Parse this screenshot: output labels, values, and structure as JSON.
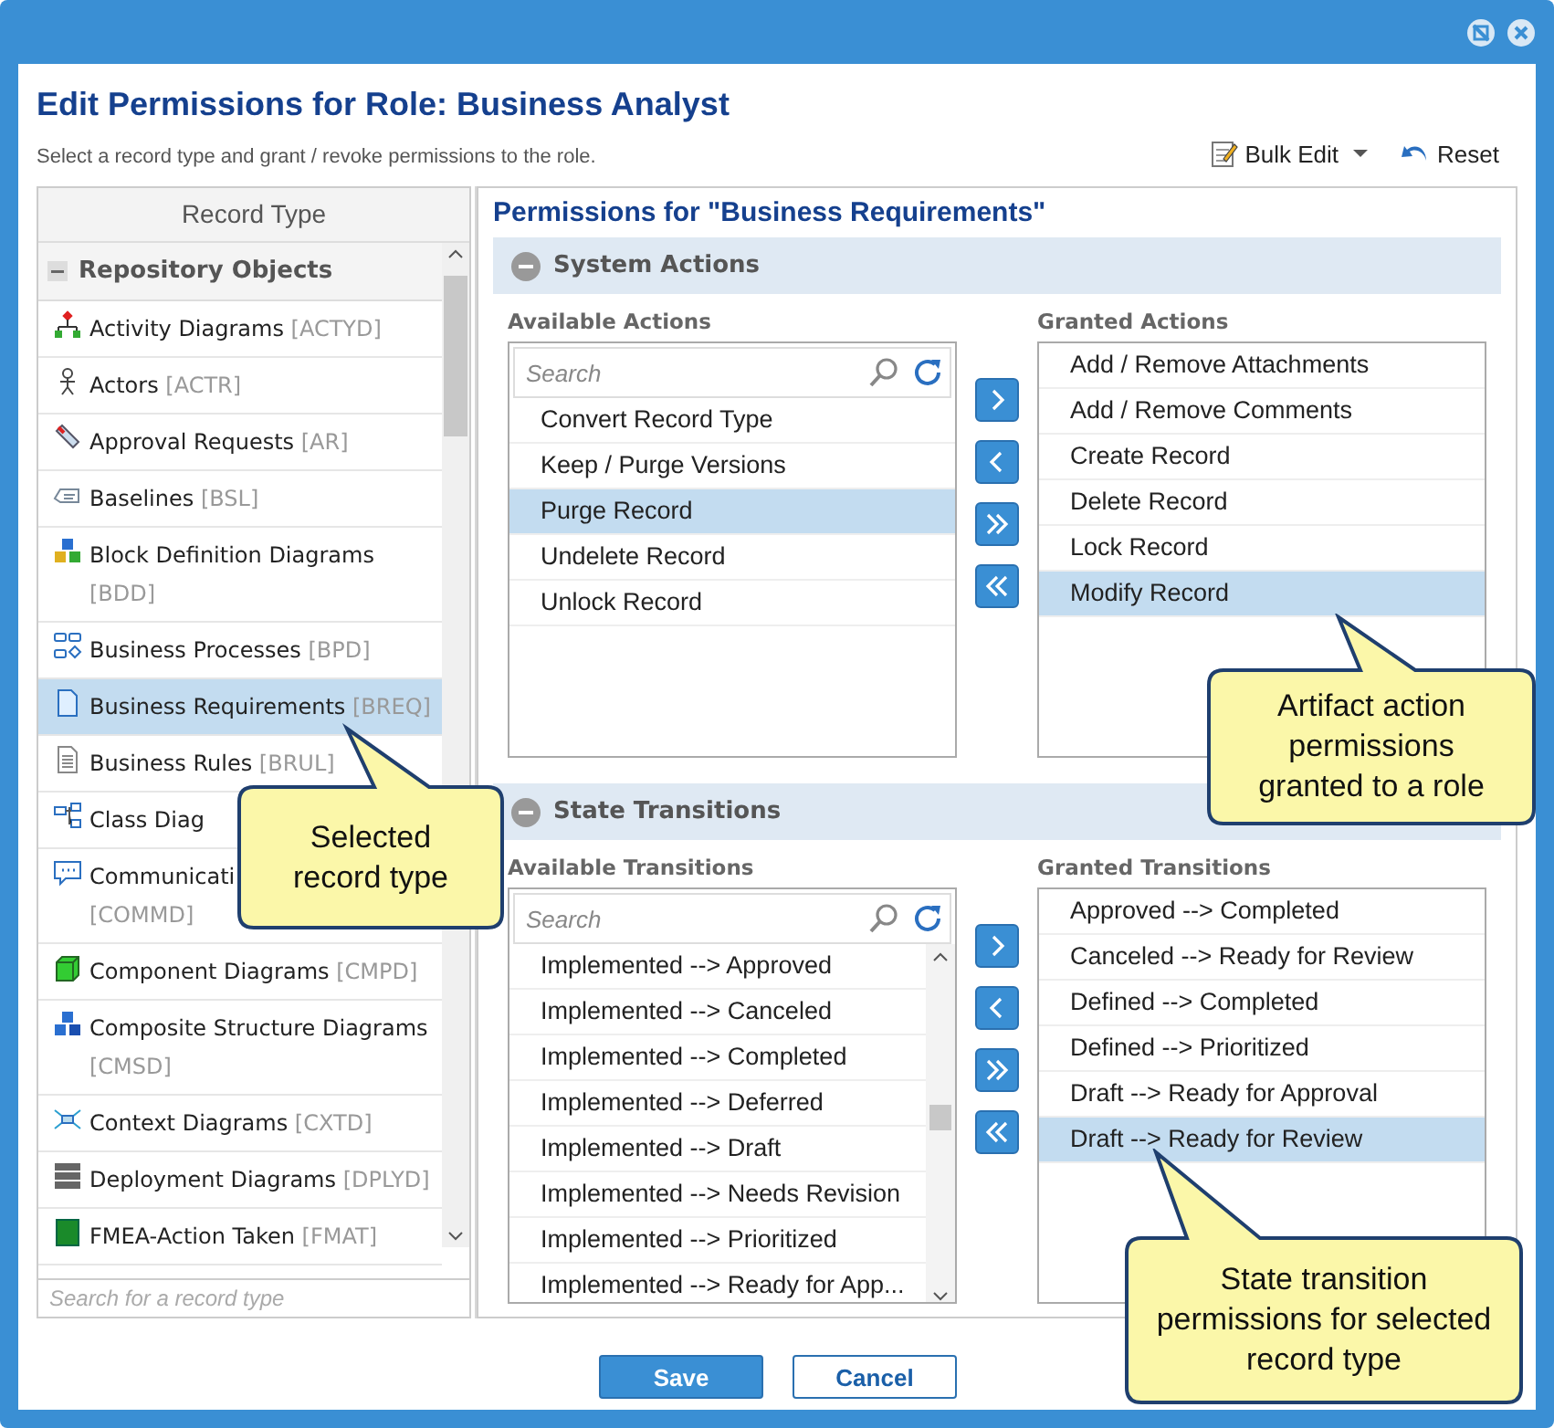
{
  "dialog": {
    "title": "Edit Permissions for Role: Business Analyst",
    "subtitle": "Select a record type and grant / revoke permissions to the role."
  },
  "toolbar": [
    {
      "label": "Bulk Edit",
      "kind": "dropdown"
    },
    {
      "label": "Reset",
      "kind": "undo"
    }
  ],
  "record_types": {
    "heading": "Record Type",
    "group": {
      "label": "Repository Objects",
      "expanded": true
    },
    "items": [
      {
        "name": "Activity Diagrams",
        "code": "[ACTYD]",
        "selected": false
      },
      {
        "name": "Actors",
        "code": "[ACTR]",
        "selected": false
      },
      {
        "name": "Approval Requests",
        "code": "[AR]",
        "selected": false
      },
      {
        "name": "Baselines",
        "code": "[BSL]",
        "selected": false
      },
      {
        "name": "Block Definition Diagrams",
        "code": "[BDD]",
        "selected": false
      },
      {
        "name": "Business Processes",
        "code": "[BPD]",
        "selected": false
      },
      {
        "name": "Business Requirements",
        "code": "[BREQ]",
        "selected": true
      },
      {
        "name": "Business Rules",
        "code": "[BRUL]",
        "selected": false
      },
      {
        "name": "Class Diag",
        "selected": false
      },
      {
        "name": "Communicati",
        "code": "[COMMD]",
        "truncated": true,
        "selected": false
      },
      {
        "name": "Component Diagrams",
        "code": "[CMPD]",
        "selected": false
      },
      {
        "name": "Composite Structure Diagrams",
        "code": "[CMSD]",
        "selected": false
      },
      {
        "name": "Context Diagrams",
        "code": "[CXTD]",
        "selected": false
      },
      {
        "name": "Deployment Diagrams",
        "code": "[DPLYD]",
        "selected": false
      },
      {
        "name": "FMEA-Action Taken",
        "code": "[FMAT]",
        "selected": false
      }
    ],
    "search": {
      "placeholder": "Search for a record type"
    }
  },
  "permissions": {
    "heading": "Permissions for \"Business Requirements\"",
    "sections": [
      {
        "title": "System Actions",
        "expanded": true,
        "available": {
          "label": "Available Actions",
          "search_placeholder": "Search",
          "items": [
            {
              "label": "Convert Record Type",
              "selected": false
            },
            {
              "label": "Keep / Purge Versions",
              "selected": false
            },
            {
              "label": "Purge Record",
              "selected": true
            },
            {
              "label": "Undelete Record",
              "selected": false
            },
            {
              "label": "Unlock Record",
              "selected": false
            }
          ]
        },
        "granted": {
          "label": "Granted Actions",
          "items": [
            {
              "label": "Add / Remove Attachments",
              "selected": false
            },
            {
              "label": "Add / Remove Comments",
              "selected": false
            },
            {
              "label": "Create Record",
              "selected": false
            },
            {
              "label": "Delete Record",
              "selected": false
            },
            {
              "label": "Lock Record",
              "selected": false
            },
            {
              "label": "Modify Record",
              "selected": true
            }
          ]
        }
      },
      {
        "title": "State Transitions",
        "expanded": true,
        "available": {
          "label": "Available Transitions",
          "search_placeholder": "Search",
          "items": [
            {
              "label": "Implemented --> Approved",
              "selected": false
            },
            {
              "label": "Implemented --> Canceled",
              "selected": false
            },
            {
              "label": "Implemented --> Completed",
              "selected": false
            },
            {
              "label": "Implemented --> Deferred",
              "selected": false
            },
            {
              "label": "Implemented --> Draft",
              "selected": false
            },
            {
              "label": "Implemented --> Needs Revision",
              "selected": false
            },
            {
              "label": "Implemented --> Prioritized",
              "selected": false
            },
            {
              "label": "Implemented --> Ready for App...",
              "selected": false
            }
          ]
        },
        "granted": {
          "label": "Granted Transitions",
          "items": [
            {
              "label": "Approved --> Completed",
              "selected": false
            },
            {
              "label": "Canceled --> Ready for Review",
              "selected": false
            },
            {
              "label": "Defined --> Completed",
              "selected": false
            },
            {
              "label": "Defined --> Prioritized",
              "selected": false
            },
            {
              "label": "Draft --> Ready for Approval",
              "selected": false
            },
            {
              "label": "Draft --> Ready for Review",
              "selected": true
            }
          ]
        }
      }
    ]
  },
  "buttons": [
    {
      "label": "Save",
      "kind": "primary"
    },
    {
      "label": "Cancel",
      "kind": "secondary"
    }
  ],
  "callouts": [
    {
      "text": "Selected record type"
    },
    {
      "text": "Artifact action permissions granted to a role"
    },
    {
      "text": "State transition permissions for selected record type"
    }
  ]
}
